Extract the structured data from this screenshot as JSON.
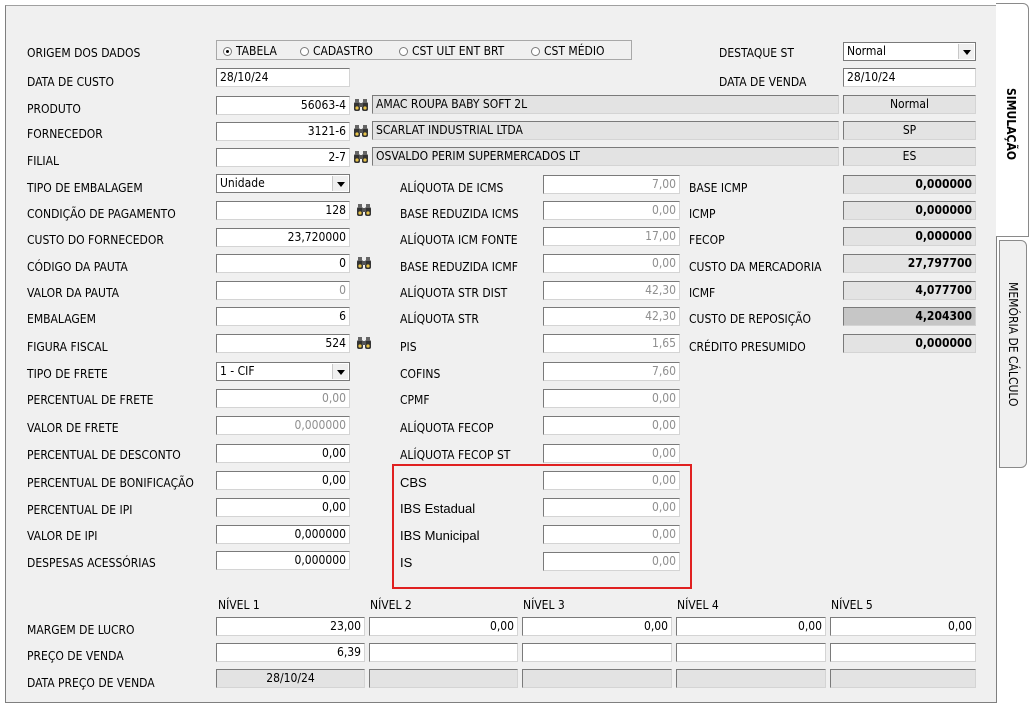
{
  "radio_group": {
    "options": [
      "TABELA",
      "CADASTRO",
      "CST ULT ENT BRT",
      "CST MÉDIO"
    ],
    "selected": "TABELA"
  },
  "left": {
    "origem": "ORIGEM DOS DADOS",
    "data_custo": "DATA DE CUSTO",
    "produto": "PRODUTO",
    "fornecedor": "FORNECEDOR",
    "filial": "FILIAL",
    "tipo_emb": "TIPO DE EMBALAGEM",
    "cond_pag": "CONDIÇÃO DE PAGAMENTO",
    "custo_forn": "CUSTO DO FORNECEDOR",
    "cod_pauta": "CÓDIGO DA PAUTA",
    "valor_pauta": "VALOR DA PAUTA",
    "embalagem": "EMBALAGEM",
    "figura_fiscal": "FIGURA FISCAL",
    "tipo_frete": "TIPO DE FRETE",
    "perc_frete": "PERCENTUAL DE  FRETE",
    "valor_frete": "VALOR DE FRETE",
    "perc_desc": "PERCENTUAL DE DESCONTO",
    "perc_bonif": "PERCENTUAL DE BONIFICAÇÃO",
    "perc_ipi": "PERCENTUAL DE IPI",
    "valor_ipi": "VALOR DE IPI",
    "desp_acess": "DESPESAS ACESSÓRIAS"
  },
  "left_values": {
    "data_custo": "28/10/24",
    "produto_cod": "56063-4",
    "produto_nome": "AMAC ROUPA BABY SOFT 2L",
    "produto_status": "Normal",
    "fornecedor_cod": "3121-6",
    "fornecedor_nome": "SCARLAT INDUSTRIAL LTDA",
    "fornecedor_uf": "SP",
    "filial_cod": "2-7",
    "filial_nome": "OSVALDO PERIM SUPERMERCADOS LT",
    "filial_uf": "ES",
    "tipo_emb": "Unidade",
    "cond_pag": "128",
    "custo_forn": "23,720000",
    "cod_pauta": "0",
    "valor_pauta": "0",
    "embalagem": "6",
    "figura_fiscal": "524",
    "tipo_frete": "1 - CIF",
    "perc_frete": "0,00",
    "valor_frete": "0,000000",
    "perc_desc": "0,00",
    "perc_bonif": "0,00",
    "perc_ipi": "0,00",
    "valor_ipi": "0,000000",
    "desp_acess": "0,000000"
  },
  "mid": {
    "labels": [
      "ALÍQUOTA DE ICMS",
      "BASE REDUZIDA ICMS",
      "ALÍQUOTA ICM FONTE",
      "BASE REDUZIDA ICMF",
      "ALÍQUOTA STR DIST",
      "ALÍQUOTA STR",
      "PIS",
      "COFINS",
      "CPMF",
      "ALÍQUOTA FECOP",
      "ALÍQUOTA FECOP ST"
    ],
    "values": [
      "7,00",
      "0,00",
      "17,00",
      "0,00",
      "42,30",
      "42,30",
      "1,65",
      "7,60",
      "0,00",
      "0,00",
      "0,00"
    ],
    "new_labels": [
      "CBS",
      "IBS Estadual",
      "IBS Municipal",
      "IS"
    ],
    "new_values": [
      "0,00",
      "0,00",
      "0,00",
      "0,00"
    ]
  },
  "right": {
    "destaque_label": "DESTAQUE ST",
    "destaque_value": "Normal",
    "data_venda_label": "DATA DE VENDA",
    "data_venda_value": "28/10/24",
    "labels": [
      "BASE ICMP",
      "ICMP",
      "FECOP",
      "CUSTO DA MERCADORIA",
      "ICMF",
      "CUSTO DE REPOSIÇÃO",
      "CRÉDITO PRESUMIDO"
    ],
    "values": [
      "0,000000",
      "0,000000",
      "0,000000",
      "27,797700",
      "4,077700",
      "4,204300",
      "0,000000"
    ]
  },
  "levels": {
    "headers": [
      "NÍVEL 1",
      "NÍVEL 2",
      "NÍVEL 3",
      "NÍVEL 4",
      "NÍVEL 5"
    ],
    "margem_label": "MARGEM DE LUCRO",
    "preco_label": "PREÇO DE VENDA",
    "data_preco_label": "DATA PREÇO DE VENDA",
    "margem": [
      "23,00",
      "0,00",
      "0,00",
      "0,00",
      "0,00"
    ],
    "preco": [
      "6,39",
      "",
      "",
      "",
      ""
    ],
    "data_preco": [
      "28/10/24",
      "",
      "",
      "",
      ""
    ]
  },
  "tabs": {
    "simulacao": "SIMULAÇÃO",
    "memoria": "MEMÓRIA DE CÁLCULO"
  }
}
